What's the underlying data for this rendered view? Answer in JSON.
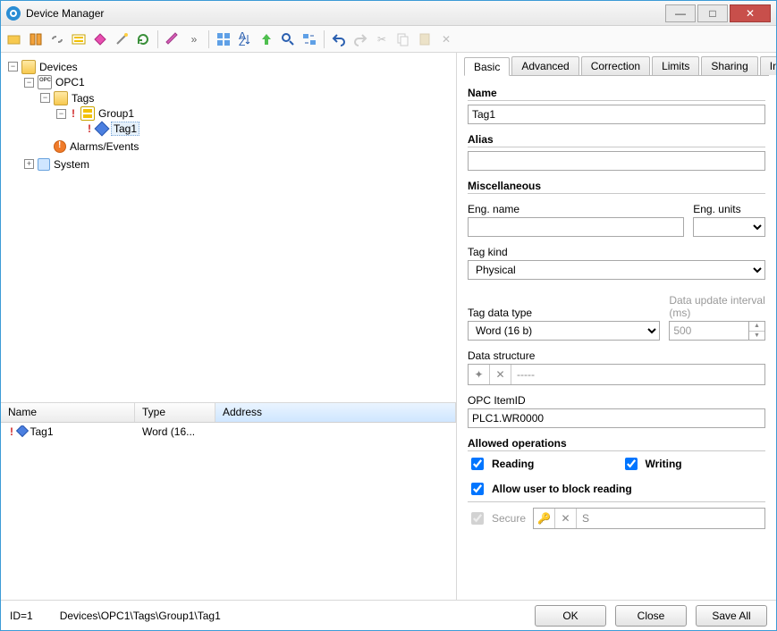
{
  "window": {
    "title": "Device Manager"
  },
  "tree": {
    "root": "Devices",
    "opc": "OPC1",
    "tags": "Tags",
    "group": "Group1",
    "tag": "Tag1",
    "alarms": "Alarms/Events",
    "system": "System"
  },
  "list": {
    "cols": {
      "name": "Name",
      "type": "Type",
      "addr": "Address"
    },
    "row": {
      "name": "Tag1",
      "type": "Word (16..."
    }
  },
  "tabs": [
    "Basic",
    "Advanced",
    "Correction",
    "Limits",
    "Sharing",
    "Information"
  ],
  "form": {
    "name_lab": "Name",
    "name_val": "Tag1",
    "alias_lab": "Alias",
    "alias_val": "",
    "misc_lab": "Miscellaneous",
    "engname_lab": "Eng. name",
    "engname_val": "",
    "engunits_lab": "Eng. units",
    "tagkind_lab": "Tag kind",
    "tagkind_val": "Physical",
    "dtype_lab": "Tag data type",
    "dtype_val": "Word (16 b)",
    "interval_lab": "Data update interval (ms)",
    "interval_val": "500",
    "dstruct_lab": "Data structure",
    "dstruct_val": "-----",
    "opcid_lab": "OPC ItemID",
    "opcid_val": "PLC1.WR0000",
    "allowed_lab": "Allowed operations",
    "reading": "Reading",
    "writing": "Writing",
    "blockread": "Allow user to block reading",
    "secure": "Secure",
    "secure_val": "S"
  },
  "footer": {
    "id": "ID=1",
    "path": "Devices\\OPC1\\Tags\\Group1\\Tag1",
    "ok": "OK",
    "close": "Close",
    "saveall": "Save All"
  }
}
